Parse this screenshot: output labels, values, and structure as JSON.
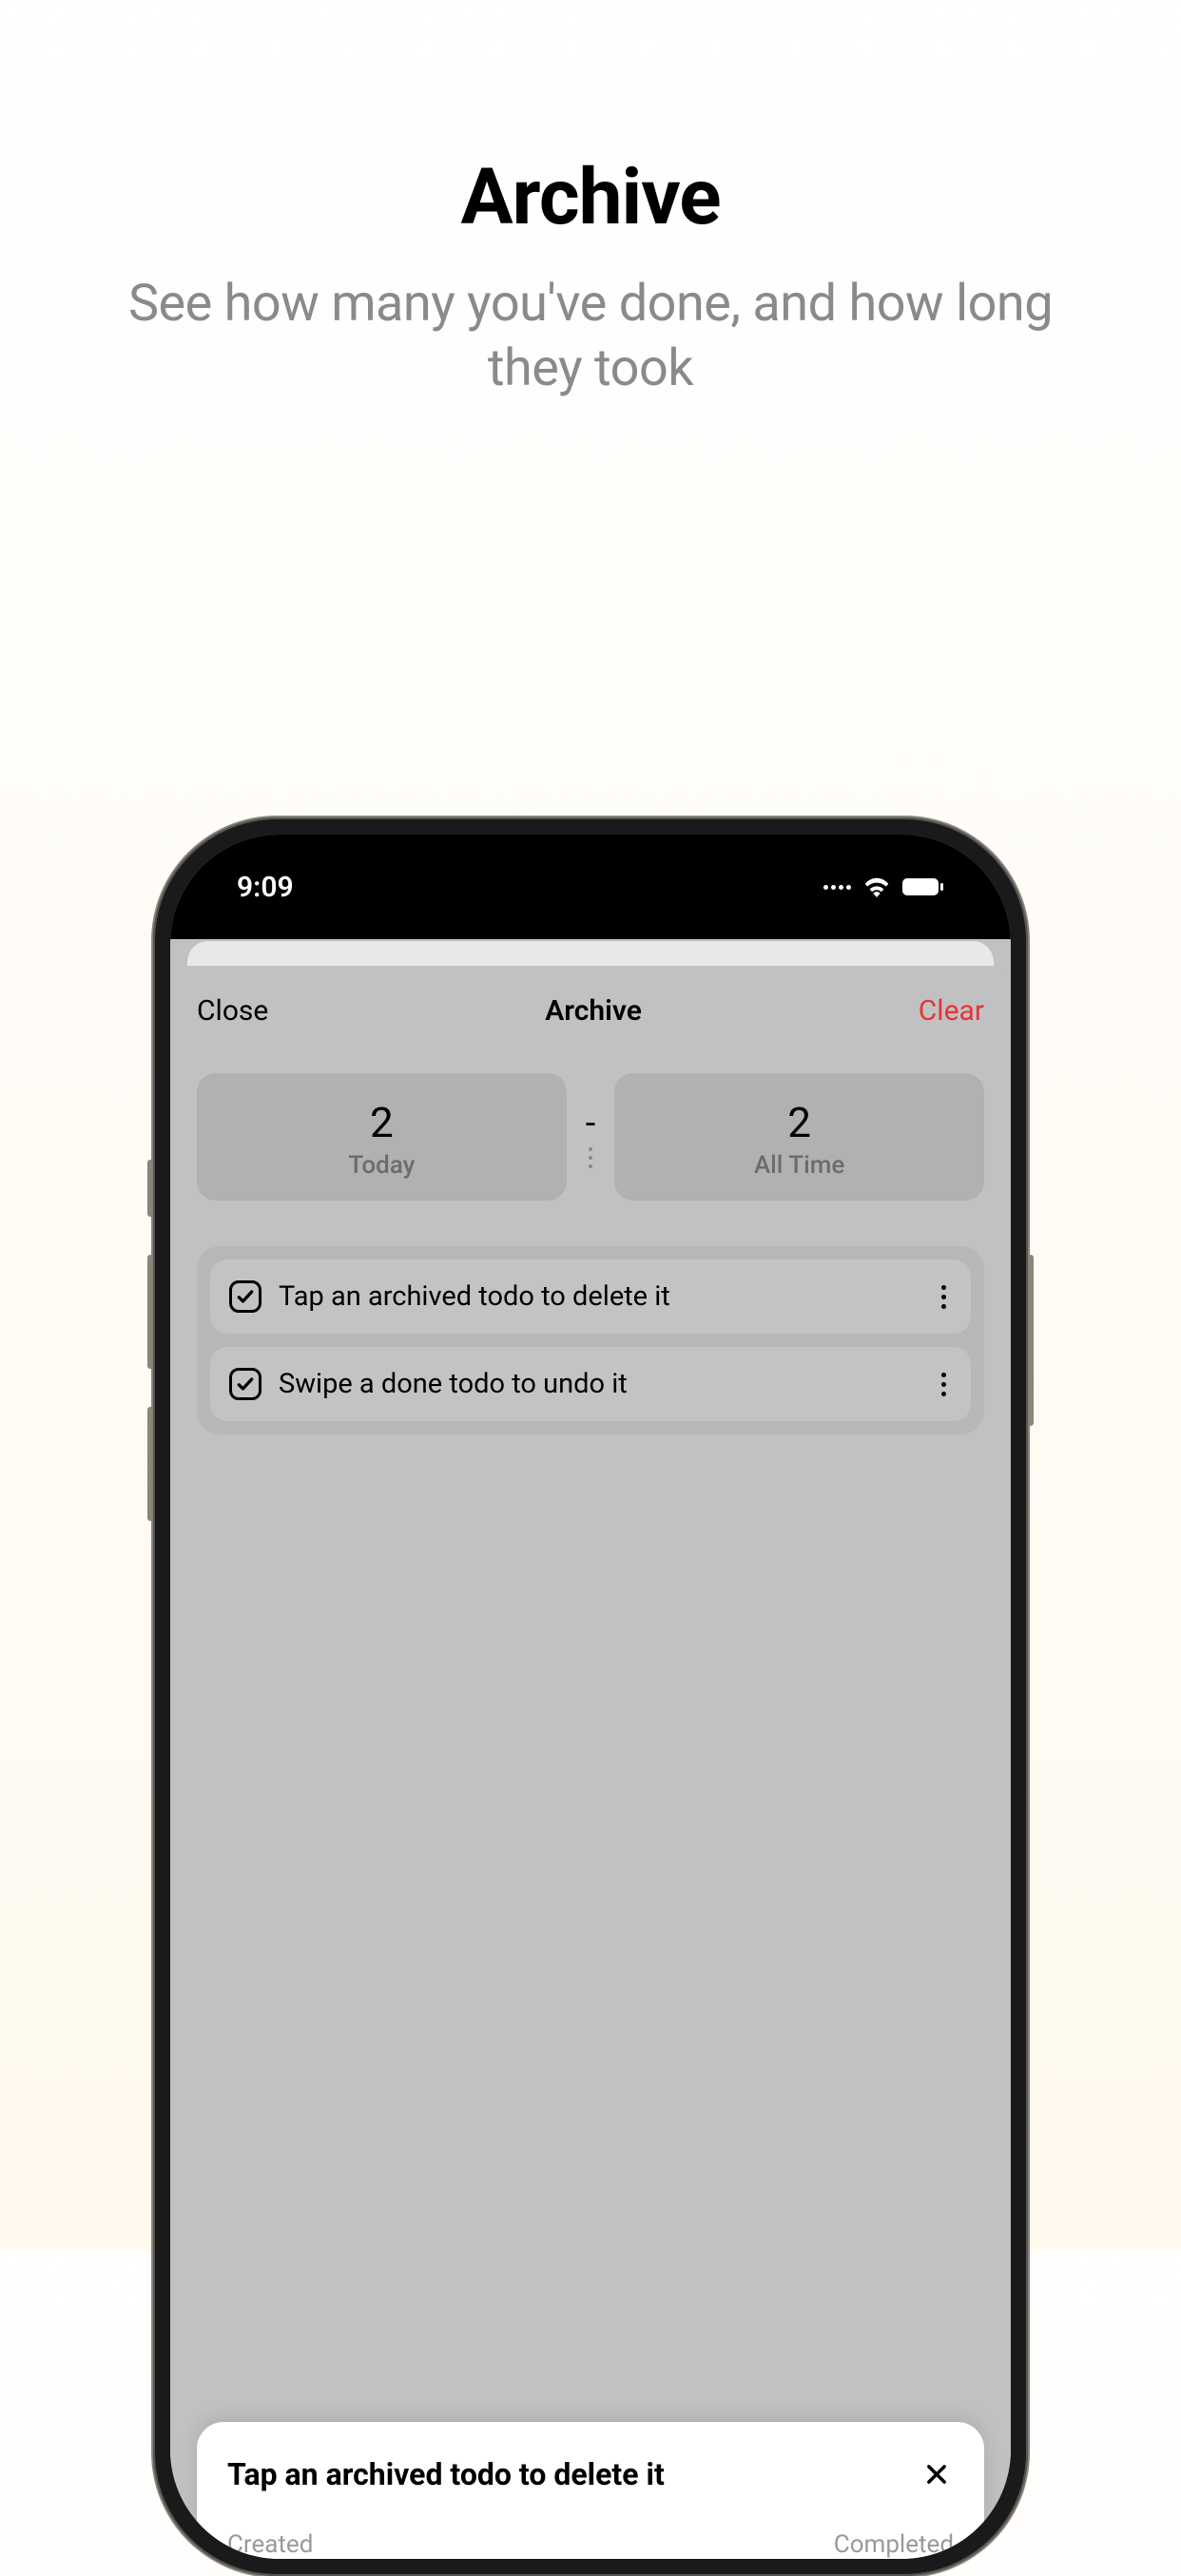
{
  "page": {
    "title": "Archive",
    "subtitle": "See how many you've done, and how long they took"
  },
  "statusBar": {
    "time": "9:09"
  },
  "modal": {
    "closeLabel": "Close",
    "title": "Archive",
    "clearLabel": "Clear"
  },
  "stats": {
    "today": {
      "value": "2",
      "label": "Today"
    },
    "divider": "-",
    "allTime": {
      "value": "2",
      "label": "All Time"
    }
  },
  "todos": [
    {
      "text": "Tap an archived todo to delete it",
      "checked": true
    },
    {
      "text": "Swipe a done todo to undo it",
      "checked": true
    }
  ],
  "detail": {
    "title": "Tap an archived todo to delete it",
    "createdLabel": "Created",
    "completedLabel": "Completed"
  },
  "colors": {
    "destructive": "#e63535"
  }
}
